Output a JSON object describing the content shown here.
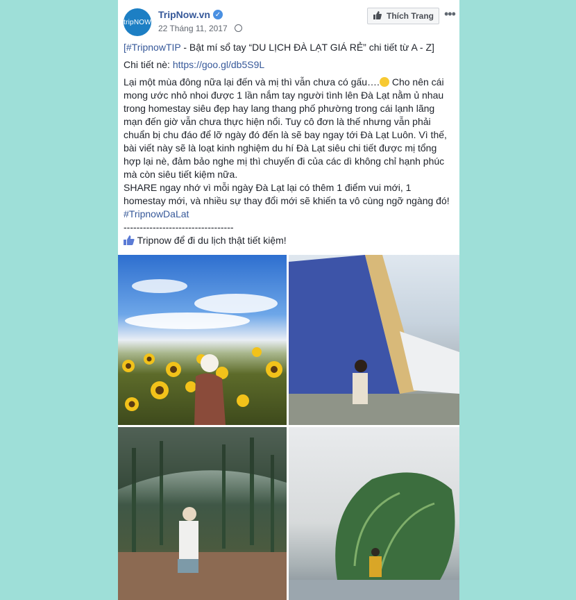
{
  "page": {
    "avatar_text": "tripNOW",
    "name": "TripNow.vn",
    "verified_icon": "verified-check-icon",
    "date": "22 Tháng 11, 2017",
    "privacy_icon": "globe-icon",
    "like_button": "Thích Trang",
    "more": "•••"
  },
  "post": {
    "line1_hashtag": "[#TripnowTIP",
    "line1_rest": " - Bật mí sổ tay “DU LỊCH ĐÀ LẠT GIÁ RẺ” chi tiết từ A - Z]",
    "link_label": "Chi tiết nè: ",
    "link_url": "https://goo.gl/db5S9L",
    "para1": "Lại một mùa đông nữa lại đến và mị thì vẫn chưa có gấu….",
    "para1b": " Cho nên cái mong ước nhỏ nhoi được 1 lần nắm tay người tình lên Đà Lạt nằm ủ nhau trong homestay siêu đẹp hay lang thang phố phường trong cái lạnh lãng mạn đến giờ vẫn chưa thực hiện nổi. Tuy cô đơn là thế nhưng vẫn phải chuẩn bị chu đáo để lỡ ngày đó đến là sẽ bay ngay tới Đà Lạt Luôn. Vì thế, bài viết này sẽ là loạt kinh nghiệm du hí Đà Lạt siêu chi tiết được mị tổng hợp lại nè, đảm bảo nghe mị thì chuyến đi của các dì không chỉ hạnh phúc mà còn siêu tiết kiệm nữa.",
    "para2": "SHARE ngay nhớ vì mỗi ngày Đà Lạt lại có thêm 1 điểm vui mới, 1 homestay mới, và nhiều sự thay đổi mới sẽ khiến ta vô cùng ngỡ ngàng đó!",
    "hashtag2": "#TripnowDaLat",
    "divider": "----------------------------------",
    "closing": " Tripnow để đi du lịch thật tiết kiệm!"
  },
  "photos": [
    {
      "name": "sunflower-field-photo"
    },
    {
      "name": "a-frame-house-photo"
    },
    {
      "name": "pine-forest-photo"
    },
    {
      "name": "glass-dome-building-photo"
    }
  ]
}
